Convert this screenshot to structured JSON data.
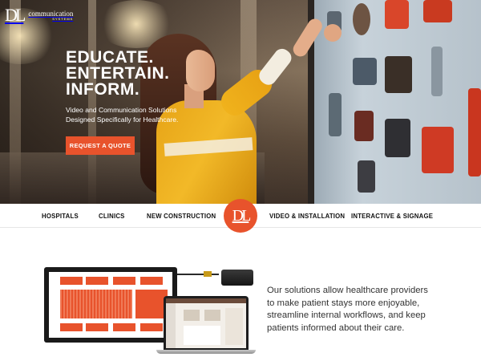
{
  "brand": {
    "mark": "DL",
    "word": "communication",
    "tagline": "SYSTEMS"
  },
  "hero": {
    "headline_lines": [
      "EDUCATE.",
      "ENTERTAIN.",
      "INFORM."
    ],
    "subtext_lines": [
      "Video and Communication Solutions",
      "Designed Specifically for Healthcare."
    ],
    "cta_label": "REQUEST A QUOTE"
  },
  "nav": {
    "items": [
      "HOSPITALS",
      "CLINICS",
      "NEW CONSTRUCTION",
      "VIDEO & INSTALLATION",
      "INTERACTIVE & SIGNAGE"
    ],
    "logo": "DL"
  },
  "content": {
    "body_lines": [
      "Our solutions allow healthcare providers",
      "to make patient stays more enjoyable,",
      "streamline internal workflows, and keep",
      "patients informed about their care."
    ]
  },
  "colors": {
    "accent": "#e8532c",
    "text_dark": "#111111",
    "body_text": "#333333"
  }
}
